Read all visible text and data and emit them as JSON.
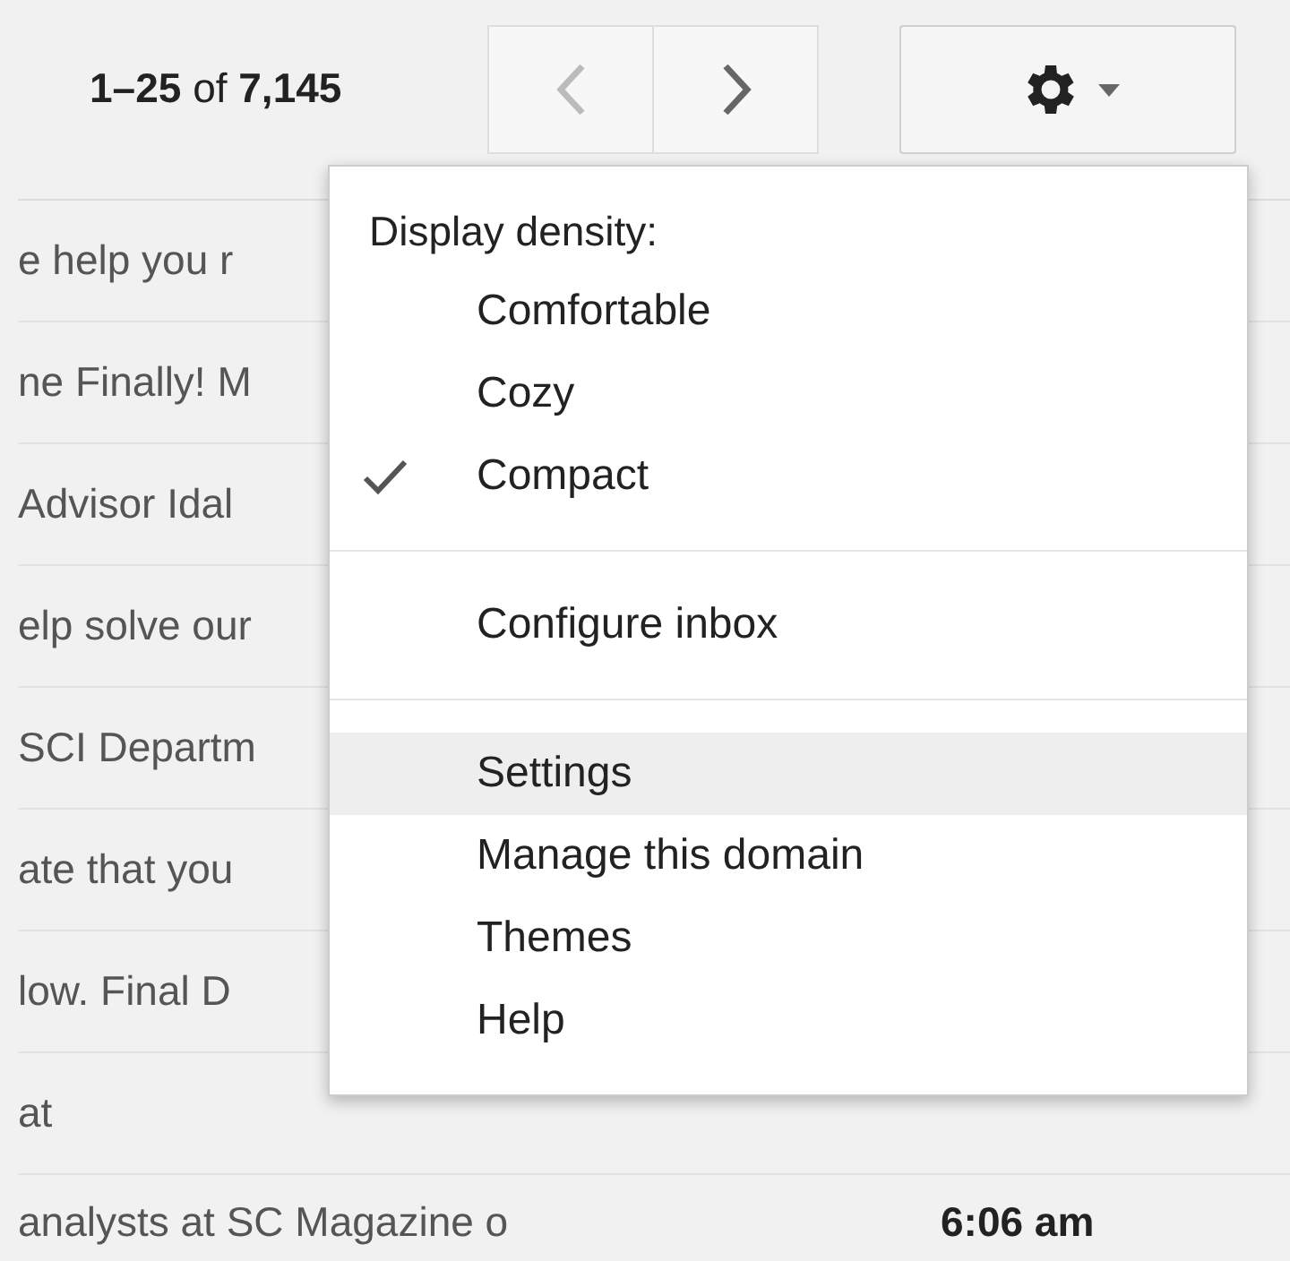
{
  "pager": {
    "range": "1–25",
    "of": "of",
    "total": "7,145"
  },
  "rows": [
    {
      "text": "e help you r"
    },
    {
      "text": "ne Finally! M"
    },
    {
      "text": "Advisor Idal"
    },
    {
      "text": "elp solve our"
    },
    {
      "text": "SCI Departm"
    },
    {
      "text": "ate that you"
    },
    {
      "text": "low. Final D"
    },
    {
      "text": "at"
    },
    {
      "text": "analysts at SC Magazine o",
      "time": "6:06 am"
    }
  ],
  "menu": {
    "heading": "Display density:",
    "sections": [
      [
        {
          "label": "Comfortable",
          "checked": false,
          "selected": false
        },
        {
          "label": "Cozy",
          "checked": false,
          "selected": false
        },
        {
          "label": "Compact",
          "checked": true,
          "selected": false
        }
      ],
      [
        {
          "label": "Configure inbox",
          "checked": false,
          "selected": false
        }
      ],
      [
        {
          "label": "Settings",
          "checked": false,
          "selected": true
        },
        {
          "label": "Manage this domain",
          "checked": false,
          "selected": false
        },
        {
          "label": "Themes",
          "checked": false,
          "selected": false
        },
        {
          "label": "Help",
          "checked": false,
          "selected": false
        }
      ]
    ]
  }
}
